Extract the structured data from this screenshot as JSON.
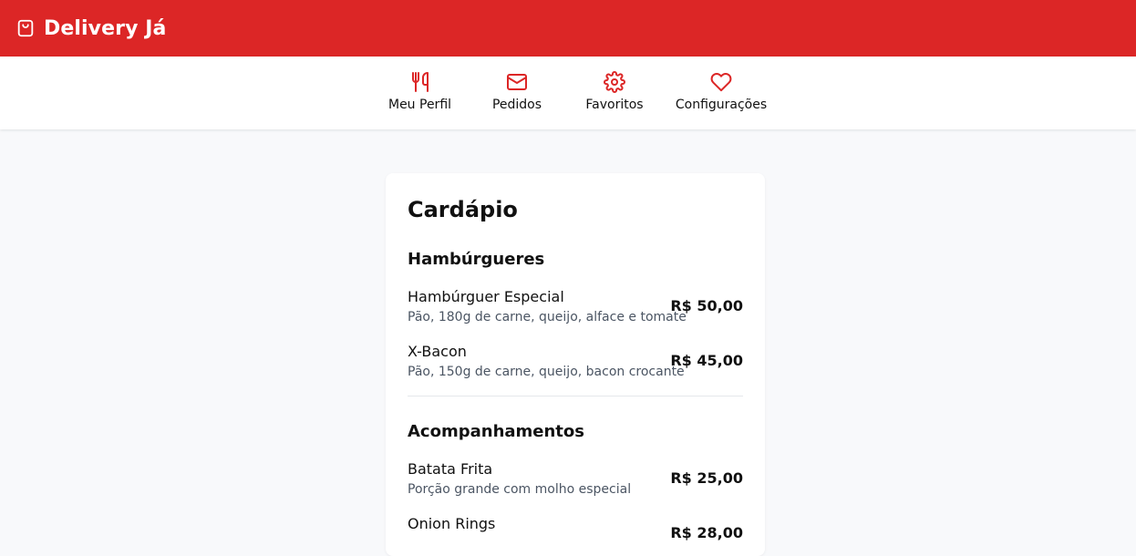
{
  "app": {
    "title": "Delivery Já",
    "brand_color": "#dc2626"
  },
  "nav": {
    "items": [
      {
        "label": "Meu Perfil",
        "icon": "utensils-icon"
      },
      {
        "label": "Pedidos",
        "icon": "mail-icon"
      },
      {
        "label": "Favoritos",
        "icon": "gear-icon"
      },
      {
        "label": "Configurações",
        "icon": "heart-icon"
      }
    ]
  },
  "menu": {
    "title": "Cardápio",
    "sections": [
      {
        "title": "Hambúrgueres",
        "items": [
          {
            "name": "Hambúrguer Especial",
            "description": "Pão, 180g de carne, queijo, alface e tomate",
            "price": "R$ 50,00"
          },
          {
            "name": "X-Bacon",
            "description": "Pão, 150g de carne, queijo, bacon crocante",
            "price": "R$ 45,00"
          }
        ]
      },
      {
        "title": "Acompanhamentos",
        "items": [
          {
            "name": "Batata Frita",
            "description": "Porção grande com molho especial",
            "price": "R$ 25,00"
          },
          {
            "name": "Onion Rings",
            "description": "",
            "price": "R$ 28,00"
          }
        ]
      }
    ]
  }
}
